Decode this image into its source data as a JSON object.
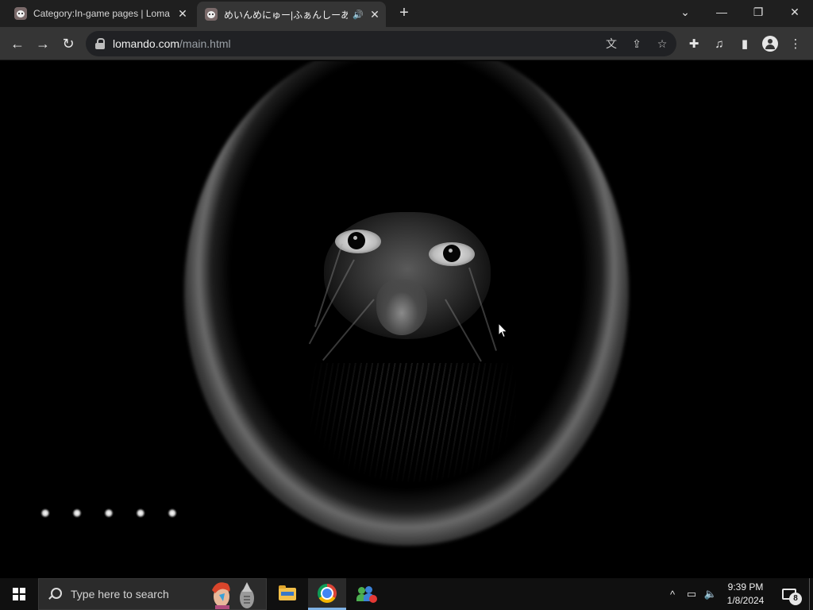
{
  "browser": {
    "tabs": [
      {
        "title": "Category:In-game pages | Loma",
        "active": false
      },
      {
        "title": "めいんめにゅー|ふぁんしーあいらん",
        "active": true
      }
    ],
    "address_bar": {
      "host": "lomando.com",
      "path": "/main.html"
    }
  },
  "page": {
    "scene": "dark hooded face artwork",
    "indicator_dots": 5
  },
  "taskbar": {
    "search_placeholder": "Type here to search",
    "clock_time": "9:39 PM",
    "clock_date": "1/8/2024",
    "notification_count": "8"
  },
  "icons": {
    "tab_close": "✕",
    "audio": "🔊",
    "new_tab": "+",
    "chevron": "⌄",
    "minimize": "—",
    "restore": "❐",
    "close": "✕",
    "back": "←",
    "forward": "→",
    "reload": "↻",
    "translate": "文",
    "share": "⇪",
    "star": "☆",
    "extensions": "✚",
    "media": "♫",
    "side_panel": "▮",
    "menu": "⋮",
    "tray_up": "^",
    "network": "▭",
    "volume": "🔈"
  },
  "colors": {
    "accent": "#7fb2e5",
    "toolbar": "#353535",
    "titlebar": "#1f1f1f",
    "taskbar": "#101010"
  }
}
